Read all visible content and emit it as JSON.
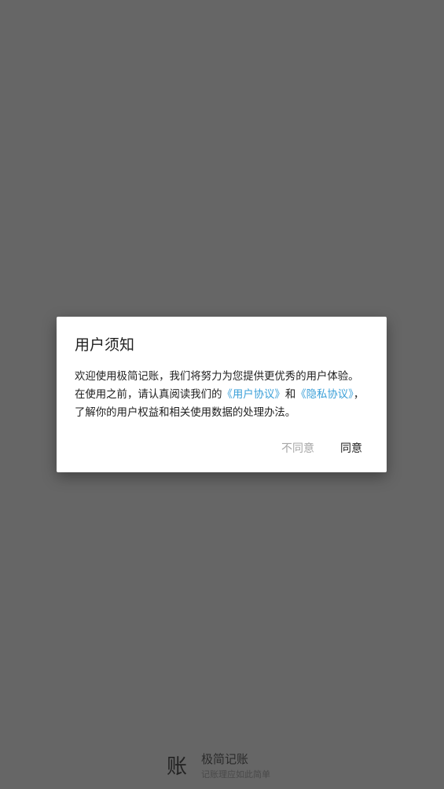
{
  "dialog": {
    "title": "用户须知",
    "body": {
      "line1": "欢迎使用极简记账，我们将努力为您提供更优秀的用户体验。",
      "line2_prefix": "在使用之前，请认真阅读我们的",
      "user_agreement_link": "《用户协议》",
      "conjunction": "和",
      "privacy_link": "《隐私协议》",
      "line2_suffix": "，",
      "line3": "了解你的用户权益和相关使用数据的处理办法。"
    },
    "disagree_label": "不同意",
    "agree_label": "同意"
  },
  "branding": {
    "icon_glyph": "账",
    "app_name": "极简记账",
    "slogan": "记账理应如此简单"
  },
  "colors": {
    "scrim": "#666666",
    "link": "#3a9fd8",
    "disabled_text": "#a6a6a6",
    "primary_text": "#212121"
  }
}
